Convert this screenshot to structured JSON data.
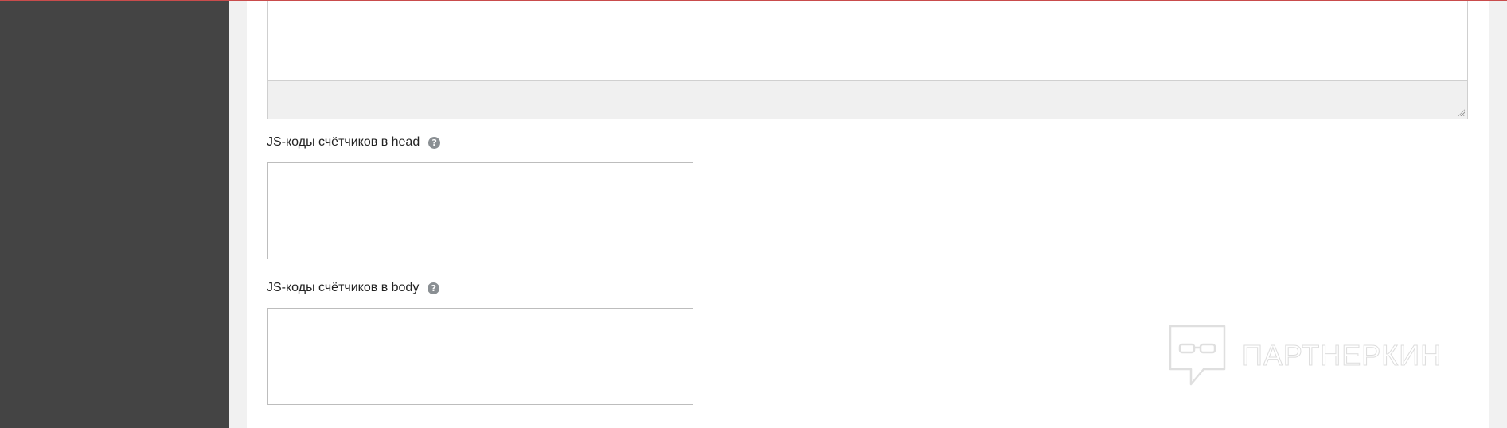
{
  "fields": {
    "head_label": "JS-коды счётчиков в head",
    "head_value": "",
    "body_label": "JS-коды счётчиков в body",
    "body_value": "",
    "help_glyph": "?"
  },
  "watermark": {
    "text": "ПАРТНЕРКИН"
  },
  "colors": {
    "sidebar": "#444444",
    "background": "#f1f1f1",
    "panel": "#ffffff",
    "top_accent": "#c94c4c",
    "help_icon": "#8a8f93"
  },
  "icons": {
    "help": "question-circle-icon",
    "watermark": "partnerkin-logo-icon",
    "resize": "resize-grip-icon"
  }
}
